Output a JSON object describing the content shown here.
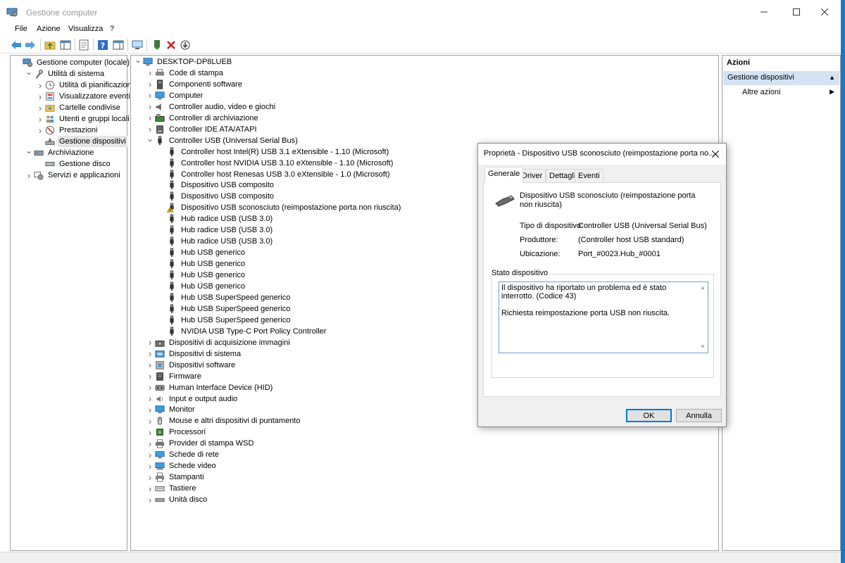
{
  "window": {
    "title": "Gestione computer"
  },
  "menu": [
    "File",
    "Azione",
    "Visualizza",
    "?"
  ],
  "left_tree": [
    {
      "label": "Gestione computer (locale)",
      "level": 0,
      "chev": "",
      "icon": "computer-management-icon"
    },
    {
      "label": "Utilità di sistema",
      "level": 1,
      "chev": "v",
      "icon": "tools-icon"
    },
    {
      "label": "Utilità di pianificazione",
      "level": 2,
      "chev": ">",
      "icon": "clock-icon"
    },
    {
      "label": "Visualizzatore eventi",
      "level": 2,
      "chev": ">",
      "icon": "event-viewer-icon"
    },
    {
      "label": "Cartelle condivise",
      "level": 2,
      "chev": ">",
      "icon": "shared-folder-icon"
    },
    {
      "label": "Utenti e gruppi locali",
      "level": 2,
      "chev": ">",
      "icon": "users-icon"
    },
    {
      "label": "Prestazioni",
      "level": 2,
      "chev": ">",
      "icon": "performance-icon"
    },
    {
      "label": "Gestione dispositivi",
      "level": 2,
      "chev": "",
      "icon": "device-manager-icon",
      "selected": true
    },
    {
      "label": "Archiviazione",
      "level": 1,
      "chev": "v",
      "icon": "storage-icon"
    },
    {
      "label": "Gestione disco",
      "level": 2,
      "chev": "",
      "icon": "disk-icon"
    },
    {
      "label": "Servizi e applicazioni",
      "level": 1,
      "chev": ">",
      "icon": "services-icon"
    }
  ],
  "device_tree": [
    {
      "label": "DESKTOP-DP8LUEB",
      "level": 0,
      "chev": "v",
      "icon": "computer-icon"
    },
    {
      "label": "Code di stampa",
      "level": 1,
      "chev": ">",
      "icon": "print-queue-icon"
    },
    {
      "label": "Componenti software",
      "level": 1,
      "chev": ">",
      "icon": "software-component-icon"
    },
    {
      "label": "Computer",
      "level": 1,
      "chev": ">",
      "icon": "monitor-icon"
    },
    {
      "label": "Controller audio, video e giochi",
      "level": 1,
      "chev": ">",
      "icon": "speaker-icon"
    },
    {
      "label": "Controller di archiviazione",
      "level": 1,
      "chev": ">",
      "icon": "storage-controller-icon"
    },
    {
      "label": "Controller IDE ATA/ATAPI",
      "level": 1,
      "chev": ">",
      "icon": "ide-icon"
    },
    {
      "label": "Controller USB (Universal Serial Bus)",
      "level": 1,
      "chev": "v",
      "icon": "usb-icon"
    },
    {
      "label": "Controller host Intel(R) USB 3.1 eXtensible - 1.10 (Microsoft)",
      "level": 2,
      "chev": "",
      "icon": "usb-icon"
    },
    {
      "label": "Controller host NVIDIA USB 3.10 eXtensible - 1.10 (Microsoft)",
      "level": 2,
      "chev": "",
      "icon": "usb-icon"
    },
    {
      "label": "Controller host Renesas USB 3.0 eXtensible - 1.0 (Microsoft)",
      "level": 2,
      "chev": "",
      "icon": "usb-icon"
    },
    {
      "label": "Dispositivo USB composito",
      "level": 2,
      "chev": "",
      "icon": "usb-icon"
    },
    {
      "label": "Dispositivo USB composito",
      "level": 2,
      "chev": "",
      "icon": "usb-icon"
    },
    {
      "label": "Dispositivo USB sconosciuto (reimpostazione porta non riuscita)",
      "level": 2,
      "chev": "",
      "icon": "usb-warning-icon"
    },
    {
      "label": "Hub radice USB (USB 3.0)",
      "level": 2,
      "chev": "",
      "icon": "usb-icon"
    },
    {
      "label": "Hub radice USB (USB 3.0)",
      "level": 2,
      "chev": "",
      "icon": "usb-icon"
    },
    {
      "label": "Hub radice USB (USB 3.0)",
      "level": 2,
      "chev": "",
      "icon": "usb-icon"
    },
    {
      "label": "Hub USB generico",
      "level": 2,
      "chev": "",
      "icon": "usb-icon"
    },
    {
      "label": "Hub USB generico",
      "level": 2,
      "chev": "",
      "icon": "usb-icon"
    },
    {
      "label": "Hub USB generico",
      "level": 2,
      "chev": "",
      "icon": "usb-icon"
    },
    {
      "label": "Hub USB generico",
      "level": 2,
      "chev": "",
      "icon": "usb-icon"
    },
    {
      "label": "Hub USB SuperSpeed generico",
      "level": 2,
      "chev": "",
      "icon": "usb-icon"
    },
    {
      "label": "Hub USB SuperSpeed generico",
      "level": 2,
      "chev": "",
      "icon": "usb-icon"
    },
    {
      "label": "Hub USB SuperSpeed generico",
      "level": 2,
      "chev": "",
      "icon": "usb-icon"
    },
    {
      "label": "NVIDIA USB Type-C Port Policy Controller",
      "level": 2,
      "chev": "",
      "icon": "usb-icon"
    },
    {
      "label": "Dispositivi di acquisizione immagini",
      "level": 1,
      "chev": ">",
      "icon": "camera-icon"
    },
    {
      "label": "Dispositivi di sistema",
      "level": 1,
      "chev": ">",
      "icon": "system-device-icon"
    },
    {
      "label": "Dispositivi software",
      "level": 1,
      "chev": ">",
      "icon": "software-device-icon"
    },
    {
      "label": "Firmware",
      "level": 1,
      "chev": ">",
      "icon": "firmware-icon"
    },
    {
      "label": "Human Interface Device (HID)",
      "level": 1,
      "chev": ">",
      "icon": "hid-icon"
    },
    {
      "label": "Input e output audio",
      "level": 1,
      "chev": ">",
      "icon": "audio-io-icon"
    },
    {
      "label": "Monitor",
      "level": 1,
      "chev": ">",
      "icon": "monitor-icon"
    },
    {
      "label": "Mouse e altri dispositivi di puntamento",
      "level": 1,
      "chev": ">",
      "icon": "mouse-icon"
    },
    {
      "label": "Processori",
      "level": 1,
      "chev": ">",
      "icon": "processor-icon"
    },
    {
      "label": "Provider di stampa WSD",
      "level": 1,
      "chev": ">",
      "icon": "print-provider-icon"
    },
    {
      "label": "Schede di rete",
      "level": 1,
      "chev": ">",
      "icon": "network-adapter-icon"
    },
    {
      "label": "Schede video",
      "level": 1,
      "chev": ">",
      "icon": "display-adapter-icon"
    },
    {
      "label": "Stampanti",
      "level": 1,
      "chev": ">",
      "icon": "printer-icon"
    },
    {
      "label": "Tastiere",
      "level": 1,
      "chev": ">",
      "icon": "keyboard-icon"
    },
    {
      "label": "Unità disco",
      "level": 1,
      "chev": ">",
      "icon": "disk-drive-icon"
    }
  ],
  "actions": {
    "title": "Azioni",
    "group": "Gestione dispositivi",
    "more": "Altre azioni"
  },
  "dialog": {
    "title": "Proprietà - Dispositivo USB sconosciuto (reimpostazione porta no...",
    "tabs": [
      "Generale",
      "Driver",
      "Dettagli",
      "Eventi"
    ],
    "device_name": "Dispositivo USB sconosciuto (reimpostazione porta non riuscita)",
    "props": [
      {
        "label": "Tipo di dispositivo:",
        "value": "Controller USB (Universal Serial Bus)"
      },
      {
        "label": "Produttore:",
        "value": "(Controller host USB standard)"
      },
      {
        "label": "Ubicazione:",
        "value": "Port_#0023.Hub_#0001"
      }
    ],
    "status_legend": "Stato dispositivo",
    "status_line1": "Il dispositivo ha riportato un problema ed è stato interrotto. (Codice 43)",
    "status_line2": "Richiesta reimpostazione porta USB non riuscita.",
    "ok": "OK",
    "cancel": "Annulla"
  },
  "colors": {
    "accent": "#0078d7",
    "selection": "#d3e3f3",
    "desktop": "#1a78c8"
  }
}
